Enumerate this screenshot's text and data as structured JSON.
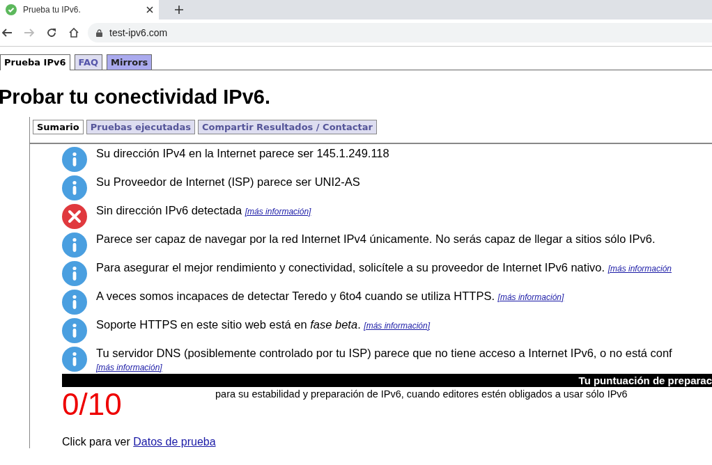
{
  "browser": {
    "tab_title": "Prueba tu IPv6.",
    "url": "test-ipv6.com"
  },
  "site_tabs": [
    {
      "label": "Prueba IPv6",
      "selected": true,
      "kind": "plain"
    },
    {
      "label": "FAQ",
      "selected": false,
      "kind": "light"
    },
    {
      "label": "Mirrors",
      "selected": false,
      "kind": "dark"
    }
  ],
  "heading": "Probar tu conectividad IPv6.",
  "panel_tabs": [
    {
      "label": "Sumario",
      "selected": true
    },
    {
      "label": "Pruebas ejecutadas",
      "selected": false
    },
    {
      "label": "Compartir Resultados / Contactar",
      "selected": false
    }
  ],
  "messages": [
    {
      "kind": "info",
      "text": "Su dirección IPv4 en la Internet parece ser 145.1.249.118"
    },
    {
      "kind": "info",
      "text": "Su Proveedor de Internet (ISP) parece ser UNI2-AS"
    },
    {
      "kind": "error",
      "text": "Sin dirección IPv6 detectada",
      "link": "[más información]"
    },
    {
      "kind": "info",
      "text": "Parece ser capaz de navegar por la red Internet IPv4 únicamente. No serás capaz de llegar a sitios sólo IPv6."
    },
    {
      "kind": "info",
      "text": "Para asegurar el mejor rendimiento y conectividad, solicítele a su proveedor de Internet IPv6 nativo.",
      "link": "[más información"
    },
    {
      "kind": "info",
      "text": "A veces somos incapaces de detectar Teredo y 6to4 cuando se utiliza HTTPS.",
      "link": "[más información]"
    },
    {
      "kind": "info",
      "text": "Soporte HTTPS en este sitio web está en *fase beta*.",
      "link": "[más información]"
    },
    {
      "kind": "info",
      "text": "Tu servidor DNS (posiblemente controlado por tu ISP) parece que no tiene acceso a Internet IPv6, o no está conf",
      "link": "[más información]",
      "link_below": true
    }
  ],
  "score": {
    "title": "Tu puntuación de preparac",
    "value": "0/10",
    "note": "para su estabilidad y preparación de IPv6, cuando editores estén obligados a usar sólo IPv6"
  },
  "footer": {
    "text": "Click para ver",
    "link": "Datos de prueba"
  }
}
